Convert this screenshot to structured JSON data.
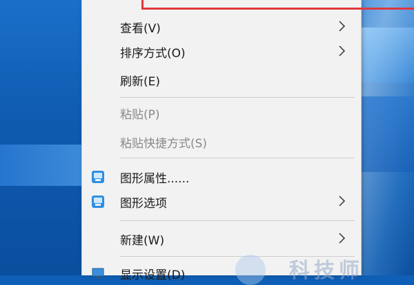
{
  "menu": {
    "items": [
      {
        "label": "查看(V)",
        "submenu": true
      },
      {
        "label": "排序方式(O)",
        "submenu": true
      },
      {
        "label": "刷新(E)",
        "submenu": false
      },
      {
        "label": "粘贴(P)",
        "submenu": false,
        "disabled": true
      },
      {
        "label": "粘贴快捷方式(S)",
        "submenu": false,
        "disabled": true
      },
      {
        "label": "图形属性......",
        "submenu": false,
        "icon": "intel-graphics-icon"
      },
      {
        "label": "图形选项",
        "submenu": true,
        "icon": "intel-graphics-icon"
      },
      {
        "label": "新建(W)",
        "submenu": true
      },
      {
        "label": "显示设置(D)",
        "submenu": false,
        "icon": "display-settings-icon"
      }
    ]
  },
  "watermark": {
    "text": "科技师"
  },
  "colors": {
    "highlight": "#e0383c",
    "menu_bg": "#f2f2f2"
  }
}
